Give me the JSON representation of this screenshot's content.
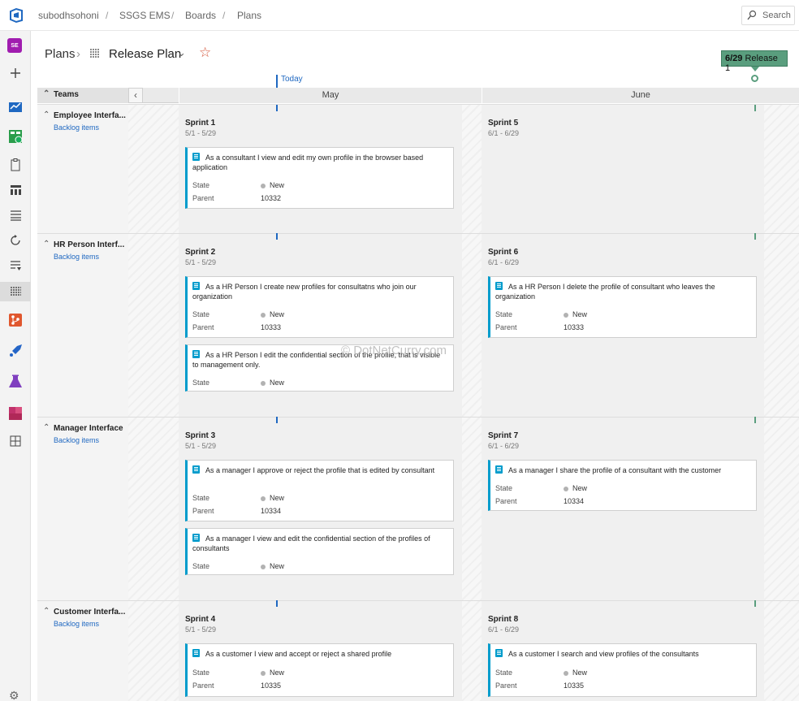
{
  "breadcrumbs": [
    "subodhsohoni",
    "SSGS EMS",
    "Boards",
    "Plans"
  ],
  "search_label": "Search",
  "user_initials": "SE",
  "page": {
    "root": "Plans",
    "plan_name": "Release Plan"
  },
  "timeline": {
    "today_label": "Today",
    "release_date": "6/29",
    "release_name": "Release 1",
    "teams_label": "Teams",
    "months": [
      "May",
      "June"
    ]
  },
  "lanes": [
    {
      "team": "Employee Interfa...",
      "backlog": "Backlog items",
      "sprints": [
        {
          "name": "Sprint 1",
          "dates": "5/1 - 5/29",
          "cards": [
            {
              "title": "As a consultant I view and edit my own profile in the browser based application",
              "state_label": "State",
              "state": "New",
              "parent_label": "Parent",
              "parent": "10332"
            }
          ]
        },
        {
          "name": "Sprint 5",
          "dates": "6/1 - 6/29",
          "cards": []
        }
      ]
    },
    {
      "team": "HR Person Interf...",
      "backlog": "Backlog items",
      "sprints": [
        {
          "name": "Sprint 2",
          "dates": "5/1 - 5/29",
          "cards": [
            {
              "title": "As a HR Person I create new profiles for consultatns who join our organization",
              "state_label": "State",
              "state": "New",
              "parent_label": "Parent",
              "parent": "10333"
            },
            {
              "title": "As a HR Person I edit the confidential section of the profile, that is visible to management only.",
              "state_label": "State",
              "state": "New"
            }
          ]
        },
        {
          "name": "Sprint 6",
          "dates": "6/1 - 6/29",
          "cards": [
            {
              "title": "As a HR Person I delete the profile of consultant who leaves the organization",
              "state_label": "State",
              "state": "New",
              "parent_label": "Parent",
              "parent": "10333"
            }
          ]
        }
      ]
    },
    {
      "team": "Manager Interface",
      "backlog": "Backlog items",
      "sprints": [
        {
          "name": "Sprint 3",
          "dates": "5/1 - 5/29",
          "cards": [
            {
              "title": "As a manager I approve or reject the profile that is edited by consultant",
              "state_label": "State",
              "state": "New",
              "parent_label": "Parent",
              "parent": "10334"
            },
            {
              "title": "As a manager I view and edit the confidential section of the profiles of consultants",
              "state_label": "State",
              "state": "New"
            }
          ]
        },
        {
          "name": "Sprint 7",
          "dates": "6/1 - 6/29",
          "cards": [
            {
              "title": "As a manager I share the profile of a consultant with the customer",
              "state_label": "State",
              "state": "New",
              "parent_label": "Parent",
              "parent": "10334"
            }
          ]
        }
      ]
    },
    {
      "team": "Customer Interfa...",
      "backlog": "Backlog items",
      "sprints": [
        {
          "name": "Sprint 4",
          "dates": "5/1 - 5/29",
          "cards": [
            {
              "title": "As a customer I view and accept or reject a shared profile",
              "state_label": "State",
              "state": "New",
              "parent_label": "Parent",
              "parent": "10335"
            }
          ]
        },
        {
          "name": "Sprint 8",
          "dates": "6/1 - 6/29",
          "cards": [
            {
              "title": "As a customer I search and view profiles of the consultants",
              "state_label": "State",
              "state": "New",
              "parent_label": "Parent",
              "parent": "10335"
            }
          ]
        }
      ]
    }
  ],
  "watermark": "© DotNetCurry.com",
  "colors": {
    "accent": "#1f68c1",
    "release": "#5a9e7e",
    "story": "#009ccc",
    "star": "#d5573b",
    "avatar": "#a01caf"
  }
}
